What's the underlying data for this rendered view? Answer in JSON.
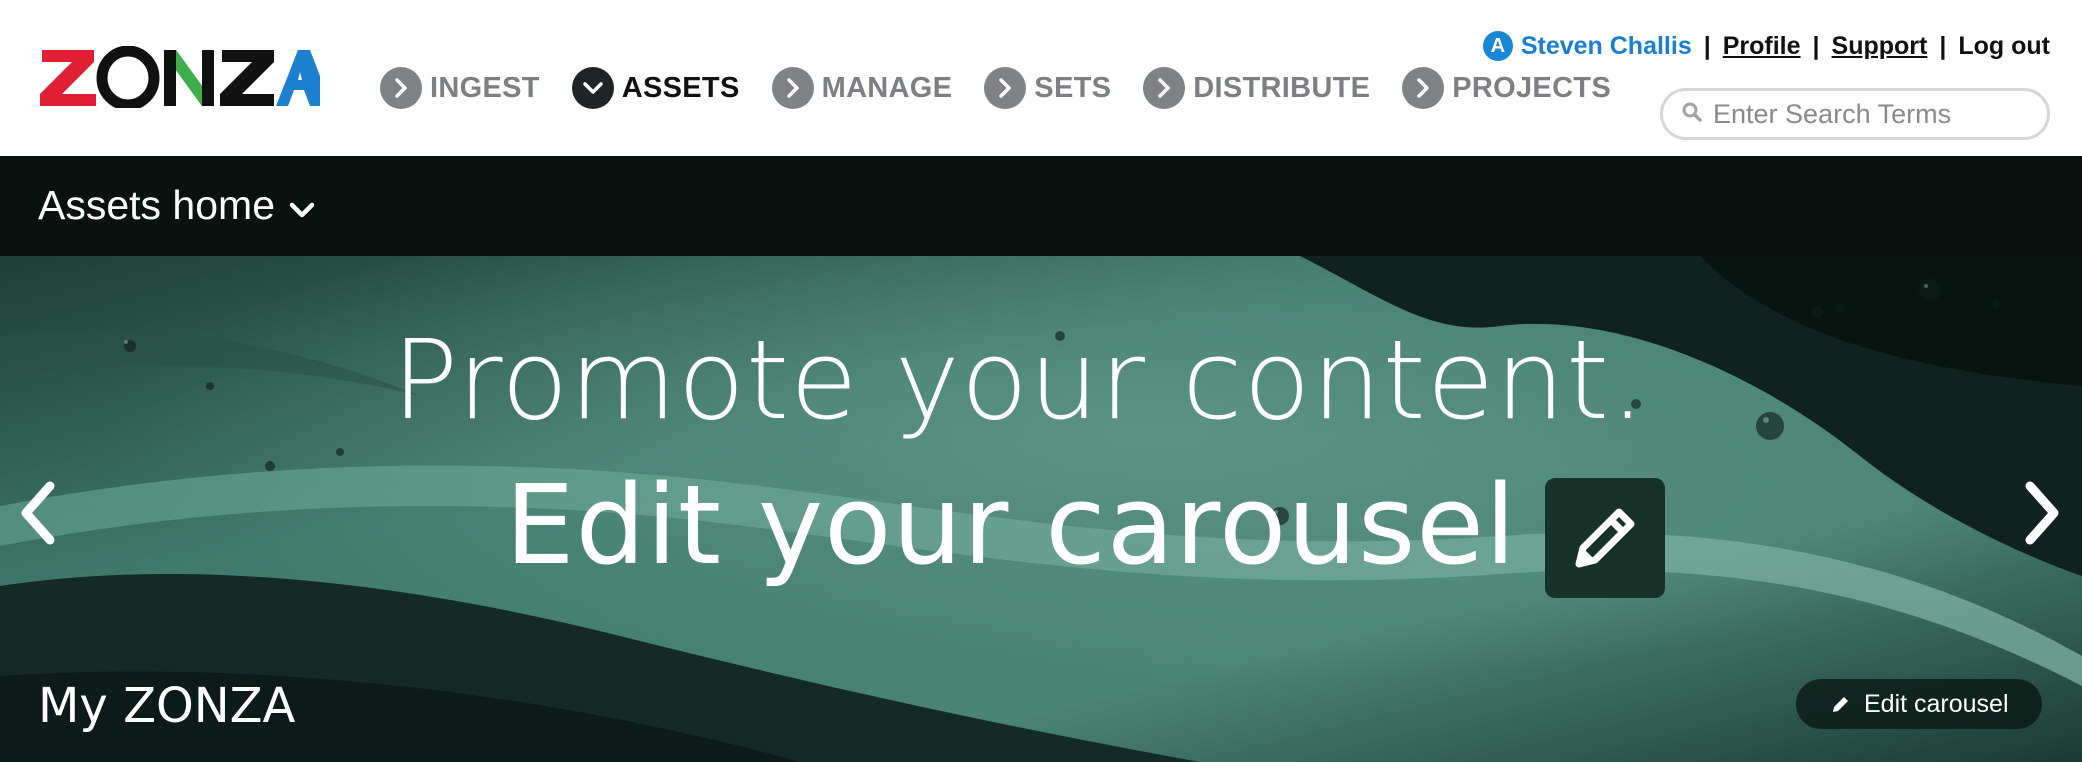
{
  "brand": {
    "logo_text": "ZONZA"
  },
  "nav": {
    "items": [
      {
        "label": "INGEST",
        "icon": "chevron-right-icon",
        "active": false
      },
      {
        "label": "ASSETS",
        "icon": "chevron-down-icon",
        "active": true
      },
      {
        "label": "MANAGE",
        "icon": "chevron-right-icon",
        "active": false
      },
      {
        "label": "SETS",
        "icon": "chevron-right-icon",
        "active": false
      },
      {
        "label": "DISTRIBUTE",
        "icon": "chevron-right-icon",
        "active": false
      },
      {
        "label": "PROJECTS",
        "icon": "chevron-right-icon",
        "active": false
      }
    ]
  },
  "user": {
    "badge": "A",
    "name": "Steven Challis",
    "separator": "|",
    "links": {
      "profile": "Profile",
      "support": "Support",
      "logout": "Log out"
    }
  },
  "search": {
    "placeholder": "Enter Search Terms",
    "value": ""
  },
  "subheader": {
    "breadcrumb": "Assets home"
  },
  "hero": {
    "line1": "Promote your content.",
    "line2": "Edit your carousel",
    "title": "My ZONZA",
    "edit_button": "Edit carousel"
  },
  "colors": {
    "accent_blue": "#1a7fcf",
    "nav_inactive": "#7d7f82",
    "nav_active": "#111111",
    "subbar_bg": "#0a1210",
    "hero_green": "#3d7466",
    "logo_red": "#e01f35",
    "logo_green": "#3dae49",
    "logo_blue": "#1d7fd0"
  }
}
